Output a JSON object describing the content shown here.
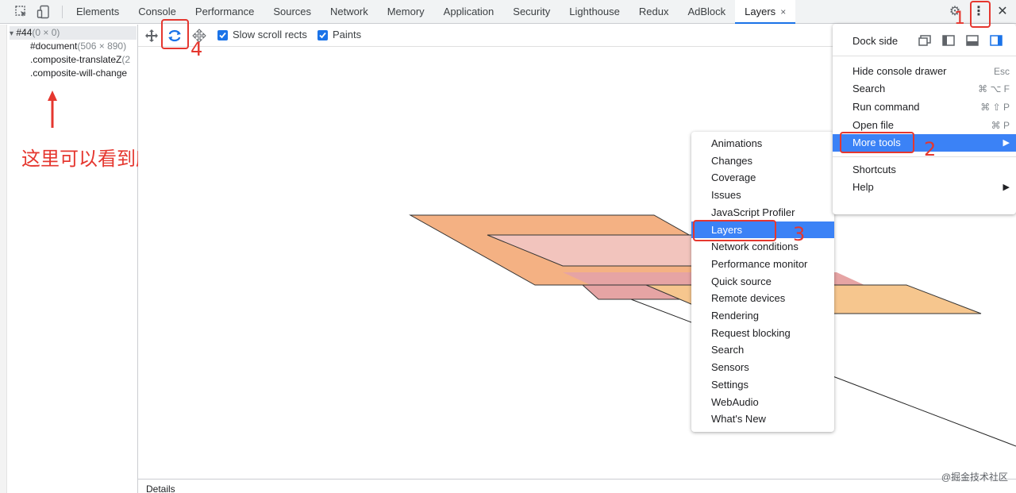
{
  "tabs": [
    {
      "label": "Elements"
    },
    {
      "label": "Console"
    },
    {
      "label": "Performance"
    },
    {
      "label": "Sources"
    },
    {
      "label": "Network"
    },
    {
      "label": "Memory"
    },
    {
      "label": "Application"
    },
    {
      "label": "Security"
    },
    {
      "label": "Lighthouse"
    },
    {
      "label": "Redux"
    },
    {
      "label": "AdBlock"
    },
    {
      "label": "Layers",
      "close": "×"
    }
  ],
  "topbar": {
    "gear": "⚙",
    "kebab": "⋮",
    "close": "✕"
  },
  "layer_tree": {
    "root_arrow": "▾",
    "root_name": "#44",
    "root_size": "(0 × 0)",
    "items": [
      {
        "name": "#document",
        "size": "(506 × 890)"
      },
      {
        "name": ".composite-translateZ",
        "size": "(2"
      },
      {
        "name": ".composite-will-change",
        "size": ""
      }
    ]
  },
  "annotation": {
    "text": "这里可以看到所有合成层"
  },
  "layers_toolbar": {
    "slow_scroll_label": "Slow scroll rects",
    "slow_scroll_checked": true,
    "paints_label": "Paints",
    "paints_checked": true
  },
  "details": {
    "label": "Details"
  },
  "watermark": "@掘金技术社区",
  "main_menu": {
    "dock_side_label": "Dock side",
    "items": [
      {
        "label": "Hide console drawer",
        "shortcut": "Esc"
      },
      {
        "label": "Search",
        "shortcut": "⌘ ⌥ F"
      },
      {
        "label": "Run command",
        "shortcut": "⌘ ⇧ P"
      },
      {
        "label": "Open file",
        "shortcut": "⌘ P"
      },
      {
        "label": "More tools",
        "arrow": "▶",
        "highlighted": true
      },
      {
        "label": "Shortcuts"
      },
      {
        "label": "Help",
        "arrow": "▶"
      }
    ]
  },
  "more_tools_menu": {
    "items": [
      {
        "label": "Animations"
      },
      {
        "label": "Changes"
      },
      {
        "label": "Coverage"
      },
      {
        "label": "Issues"
      },
      {
        "label": "JavaScript Profiler"
      },
      {
        "label": "Layers",
        "highlighted": true
      },
      {
        "label": "Network conditions"
      },
      {
        "label": "Performance monitor"
      },
      {
        "label": "Quick source"
      },
      {
        "label": "Remote devices"
      },
      {
        "label": "Rendering"
      },
      {
        "label": "Request blocking"
      },
      {
        "label": "Search"
      },
      {
        "label": "Sensors"
      },
      {
        "label": "Settings"
      },
      {
        "label": "WebAudio"
      },
      {
        "label": "What's New"
      }
    ]
  },
  "step_numbers": {
    "one": "1",
    "two": "2",
    "three": "3",
    "four": "4"
  },
  "colors": {
    "accent": "#1a73e8",
    "menu_highlight": "#3b82f6",
    "annotation_red": "#e5372f",
    "layer_orange": "#f4b183",
    "layer_pink": "#f2c4bd",
    "layer_rose": "#e6a4a4",
    "layer_yellow": "#f6c68e"
  }
}
